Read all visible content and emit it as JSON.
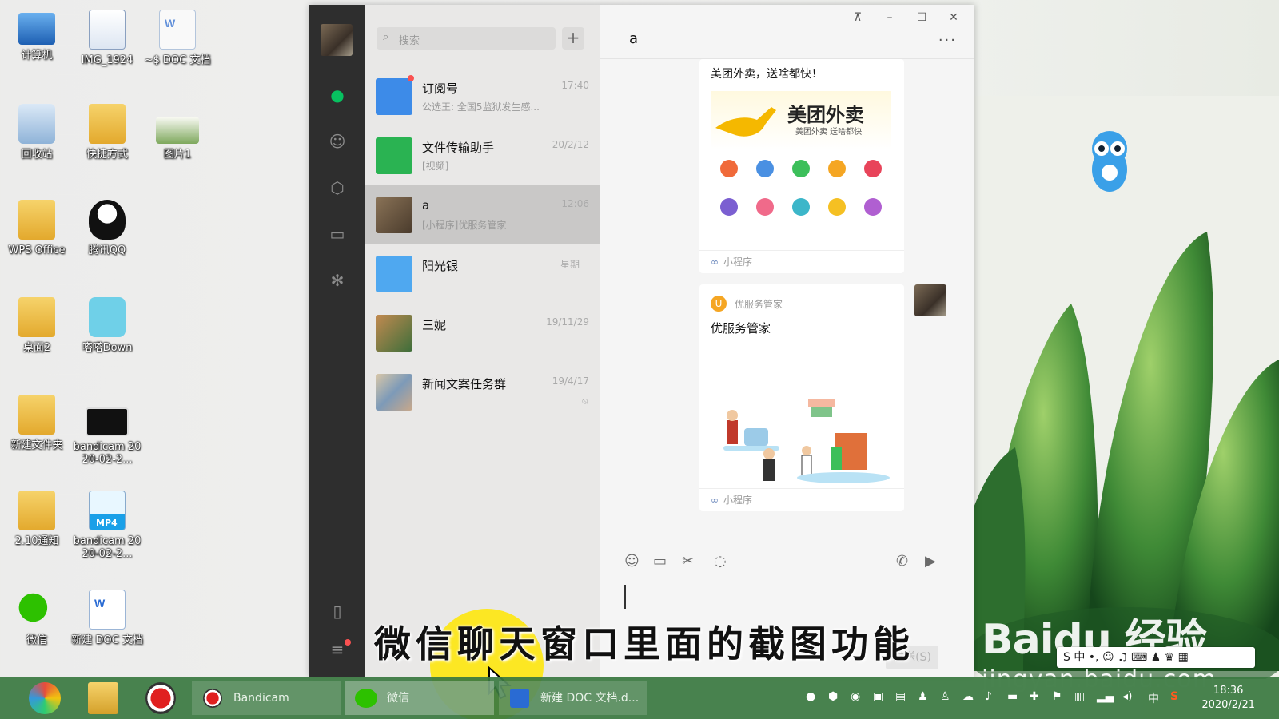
{
  "desktop": {
    "icons": [
      {
        "label": "计算机"
      },
      {
        "label": "IMG_1924"
      },
      {
        "label": "~$ DOC 文档"
      },
      {
        "label": "回收站"
      },
      {
        "label": "快捷方式"
      },
      {
        "label": "图片1"
      },
      {
        "label": "WPS Office"
      },
      {
        "label": "腾讯QQ"
      },
      {
        "label": "桌面2"
      },
      {
        "label": "嗒嗒Down"
      },
      {
        "label": "新建文件夹"
      },
      {
        "label": "bandicam 2020-02-2..."
      },
      {
        "label": "2.10通知"
      },
      {
        "label": "bandicam 2020-02-2..."
      },
      {
        "label": "微信"
      },
      {
        "label": "新建 DOC 文档"
      }
    ],
    "mp4_badge": "MP4"
  },
  "wechat": {
    "search_placeholder": "搜索",
    "plus_label": "+",
    "window_controls": {
      "pin": "⊼",
      "minimize": "–",
      "maximize": "☐",
      "close": "✕"
    },
    "chats": [
      {
        "name": "订阅号",
        "preview": "公选王: 全国5监狱发生感...",
        "time": "17:40",
        "unread": true
      },
      {
        "name": "文件传输助手",
        "preview": "[视频]",
        "time": "20/2/12"
      },
      {
        "name": "a",
        "preview": "[小程序]优服务管家",
        "time": "12:06",
        "selected": true
      },
      {
        "name": "阳光银",
        "preview": "",
        "time": "星期一"
      },
      {
        "name": "三妮",
        "preview": "",
        "time": "19/11/29"
      },
      {
        "name": "新闻文案任务群",
        "preview": "",
        "time": "19/4/17",
        "muted": true
      }
    ],
    "active_chat": {
      "title": "a",
      "more": "···",
      "messages": [
        {
          "type": "mini-program",
          "caption": "美团外卖，送啥都快！",
          "brand": "美团外卖",
          "slogan": "美团外卖 送啥都快",
          "footer": "小程序"
        },
        {
          "type": "mini-program",
          "app_name": "优服务管家",
          "title": "优服务管家",
          "footer": "小程序"
        }
      ],
      "send_button": "发送(S)"
    }
  },
  "overlay": {
    "subtitle": "微信聊天窗口里面的截图功能",
    "watermark_main": "Baidu 经验",
    "watermark_url": "jingyan.baidu.com"
  },
  "ime": {
    "text": "S 中 •, ☺ ♫ ⌨ ♟ ♛ ▦"
  },
  "taskbar": {
    "tasks": [
      {
        "label": "Bandicam"
      },
      {
        "label": "微信"
      },
      {
        "label": "新建 DOC 文档.d..."
      }
    ],
    "tray_lang": "中",
    "time": "18:36",
    "date": "2020/2/21"
  }
}
